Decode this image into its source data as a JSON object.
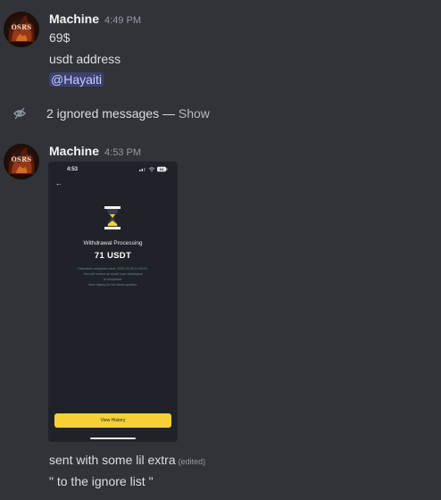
{
  "messages": [
    {
      "author": "Machine",
      "time": "4:49 PM",
      "avatar_label": "OSRS",
      "lines": [
        "69$",
        "usdt address"
      ],
      "mention": "@Hayaiti"
    },
    {
      "author": "Machine",
      "time": "4:53 PM",
      "avatar_label": "OSRS",
      "attachment": {
        "status_time": "4:53",
        "battery": "64",
        "title": "Withdrawal Processing",
        "amount": "71 USDT",
        "desc_lines": [
          "Estimated completion time: 2025-04-08 14:40:10.",
          "You will receive an email once withdrawal",
          "is completed.",
          "View history for the latest updates."
        ],
        "button": "View History"
      },
      "text": "sent with some lil extra",
      "edited_label": "(edited)",
      "followup": "\" to the ignore list \""
    }
  ],
  "ignored": {
    "text": "2 ignored messages — ",
    "action": "Show",
    "icon": "eye-slash-icon"
  },
  "colors": {
    "background": "#313338",
    "mention_bg": "#3c4270",
    "accent_yellow": "#f5d135"
  }
}
